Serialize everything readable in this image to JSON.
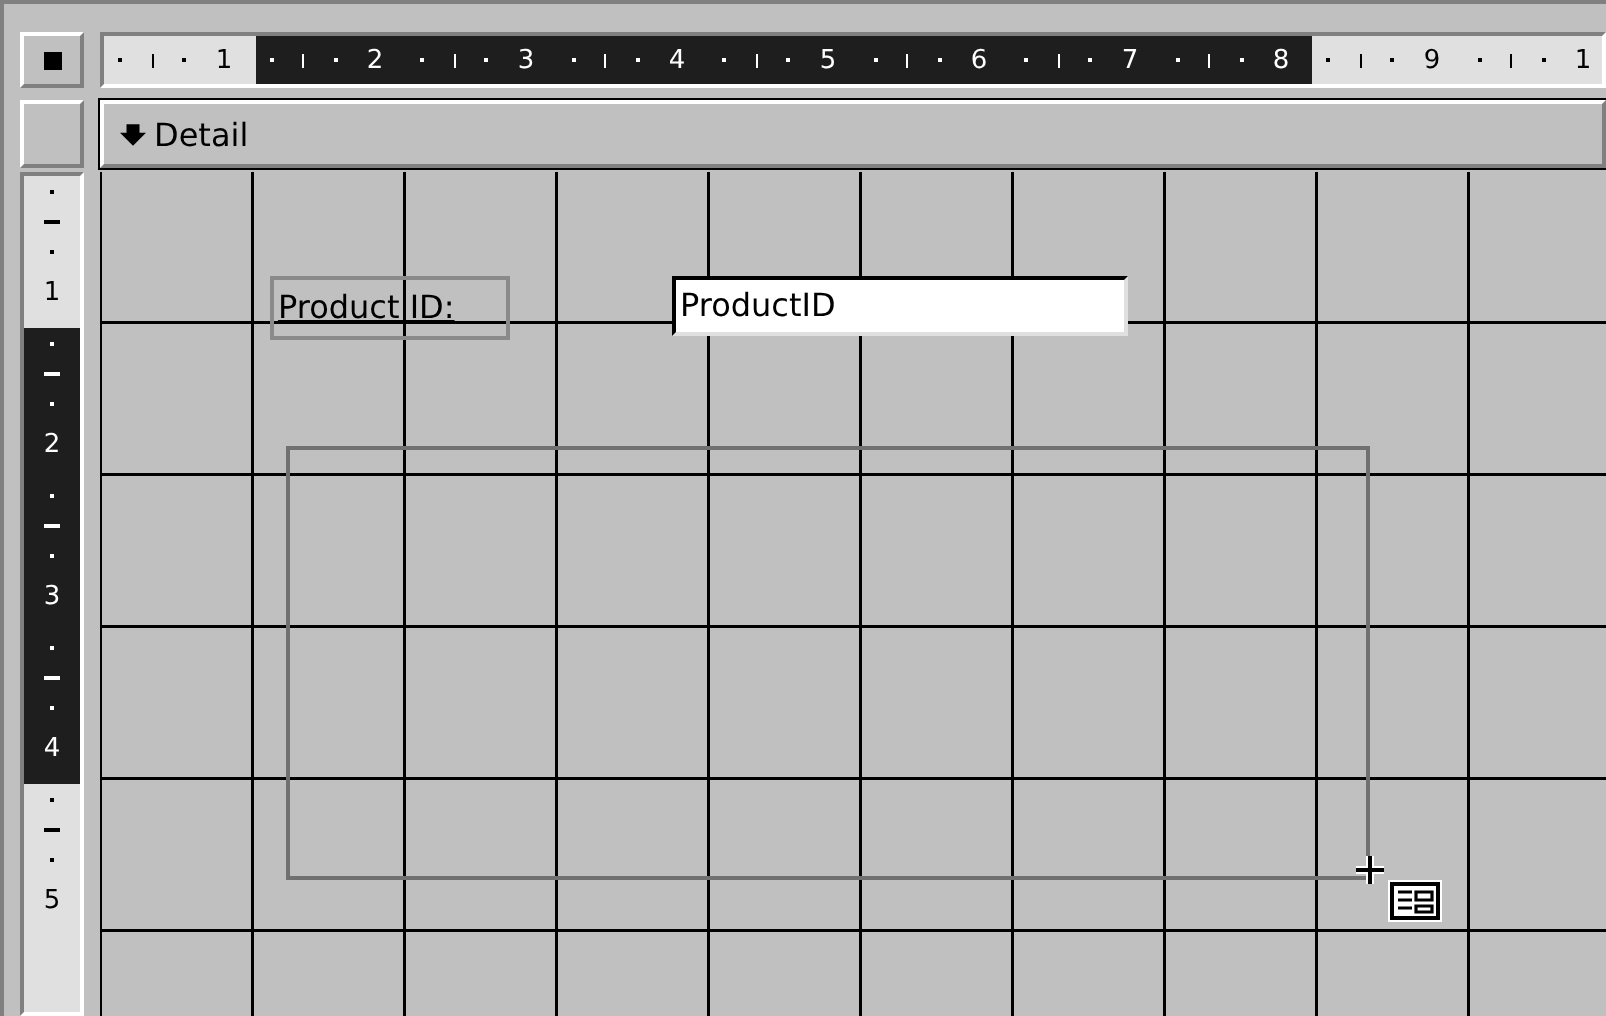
{
  "rulers": {
    "horizontal": [
      {
        "label": "1",
        "selected": false
      },
      {
        "label": "2",
        "selected": true
      },
      {
        "label": "3",
        "selected": true
      },
      {
        "label": "4",
        "selected": true
      },
      {
        "label": "5",
        "selected": true
      },
      {
        "label": "6",
        "selected": true
      },
      {
        "label": "7",
        "selected": true
      },
      {
        "label": "8",
        "selected": true
      },
      {
        "label": "9",
        "selected": false
      },
      {
        "label": "1",
        "selected": false
      }
    ],
    "vertical": [
      {
        "label": "1",
        "selected": false
      },
      {
        "label": "2",
        "selected": true
      },
      {
        "label": "3",
        "selected": true
      },
      {
        "label": "4",
        "selected": true
      },
      {
        "label": "5",
        "selected": false
      }
    ]
  },
  "section": {
    "title": "Detail"
  },
  "controls": [
    {
      "kind": "label",
      "text": "Product ID:"
    },
    {
      "kind": "textbox",
      "text": "ProductID"
    }
  ]
}
